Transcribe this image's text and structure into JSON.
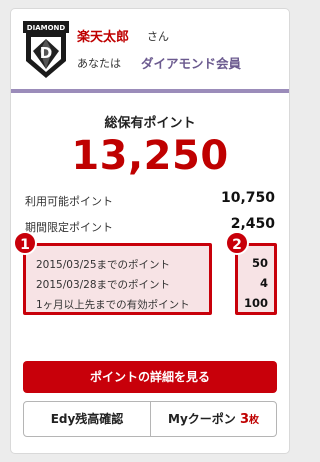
{
  "user": {
    "name": "楽天太郎",
    "suffix": "さん",
    "rank_prefix": "あなたは",
    "rank": "ダイアモンド会員",
    "badge_text": "DIAMOND",
    "badge_letter": "D"
  },
  "points": {
    "total_label": "総保有ポイント",
    "total": "13,250",
    "available_label": "利用可能ポイント",
    "available": "10,750",
    "limited_label": "期間限定ポイント",
    "limited": "2,450"
  },
  "expiry": [
    {
      "label": "2015/03/25までのポイント",
      "value": "50"
    },
    {
      "label": "2015/03/28までのポイント",
      "value": "4"
    },
    {
      "label": "1ヶ月以上先までの有効ポイント",
      "value": "100"
    }
  ],
  "markers": [
    "1",
    "2"
  ],
  "actions": {
    "detail": "ポイントの詳細を見る",
    "edy": "Edy残高確認",
    "coupon": "Myクーポン",
    "coupon_count": "3",
    "coupon_unit": "枚"
  },
  "colors": {
    "accent": "#bf0000",
    "rank": "#6b5a8f",
    "divider": "#9b8cba",
    "highlight": "#c8000a"
  }
}
